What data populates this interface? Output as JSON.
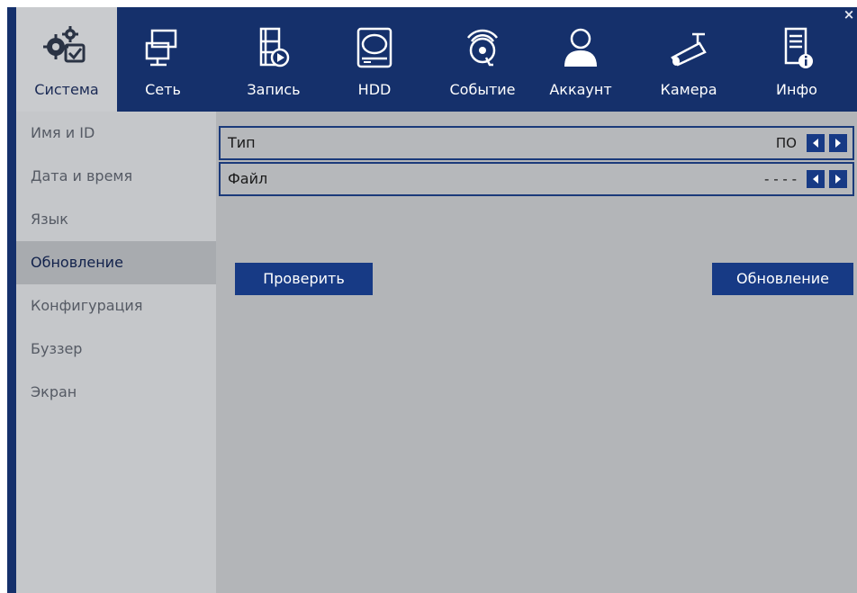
{
  "tabs": [
    {
      "label": "Система",
      "icon": "gears-check-icon",
      "active": true
    },
    {
      "label": "Сеть",
      "icon": "network-monitors-icon"
    },
    {
      "label": "Запись",
      "icon": "film-record-icon"
    },
    {
      "label": "HDD",
      "icon": "hard-drive-icon"
    },
    {
      "label": "Событие",
      "icon": "alarm-bell-icon"
    },
    {
      "label": "Аккаунт",
      "icon": "user-account-icon"
    },
    {
      "label": "Камера",
      "icon": "bullet-camera-icon"
    },
    {
      "label": "Инфо",
      "icon": "info-document-icon"
    }
  ],
  "close_label": "×",
  "sidebar": {
    "items": [
      {
        "label": "Имя и ID"
      },
      {
        "label": "Дата и время"
      },
      {
        "label": "Язык"
      },
      {
        "label": "Обновление",
        "active": true
      },
      {
        "label": "Конфигурация"
      },
      {
        "label": "Буззер"
      },
      {
        "label": "Экран"
      }
    ]
  },
  "fields": {
    "type": {
      "label": "Тип",
      "value": "ПО"
    },
    "file": {
      "label": "Файл",
      "value": "- - - -"
    }
  },
  "buttons": {
    "check": "Проверить",
    "update": "Обновление"
  },
  "colors": {
    "header_bg": "#15306b",
    "accent": "#173a85",
    "sidebar_bg": "#c5c7ca",
    "content_bg": "#b3b5b8"
  }
}
